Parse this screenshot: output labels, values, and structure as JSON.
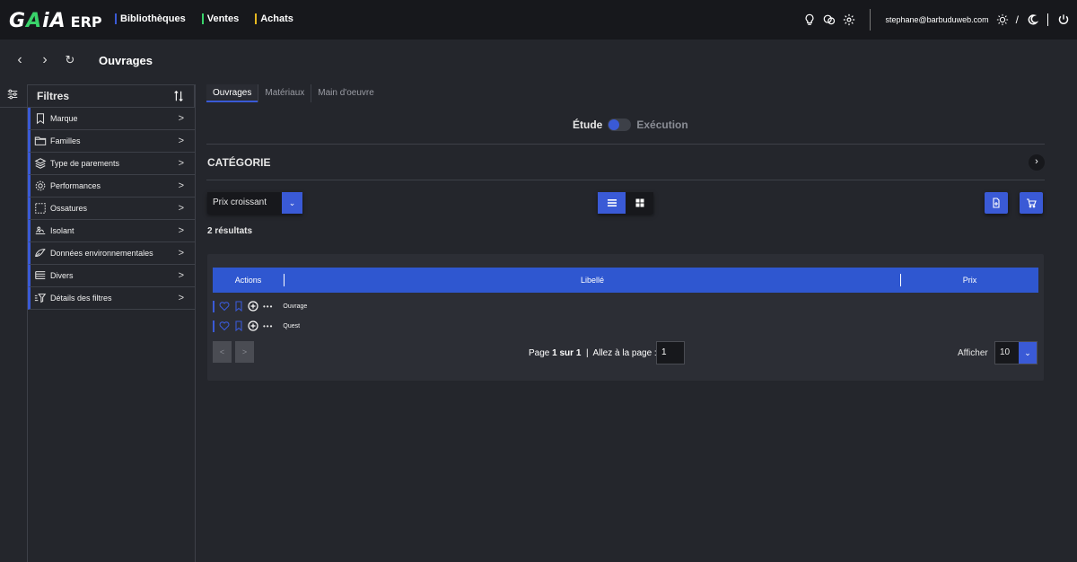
{
  "app": {
    "logo_text": "GAiA",
    "logo_suffix": "ERP"
  },
  "topnav": [
    {
      "label": "Bibliothèques",
      "color": "#3a5ad6"
    },
    {
      "label": "Ventes",
      "color": "#39d36a"
    },
    {
      "label": "Achats",
      "color": "#e6b820"
    }
  ],
  "topright": {
    "icons": [
      "lightbulb-icon",
      "chat-icon",
      "gear-icon"
    ],
    "email": "stephane@barbuduweb.com",
    "theme_separator": "/",
    "theme_icons": [
      "sun-icon",
      "moon-icon"
    ],
    "power_icon": "power-icon"
  },
  "subheader": {
    "back": "‹",
    "forward": "›",
    "refresh": "↻",
    "title": "Ouvrages"
  },
  "filters": {
    "title": "Filtres",
    "items": [
      {
        "label": "Marque",
        "icon": "bookmark-icon"
      },
      {
        "label": "Familles",
        "icon": "folder-icon"
      },
      {
        "label": "Type de parements",
        "icon": "layers-icon"
      },
      {
        "label": "Performances",
        "icon": "cog-icon"
      },
      {
        "label": "Ossatures",
        "icon": "frame-icon"
      },
      {
        "label": "Isolant",
        "icon": "insulation-icon"
      },
      {
        "label": "Données environnementales",
        "icon": "leaf-icon"
      },
      {
        "label": "Divers",
        "icon": "list-icon"
      },
      {
        "label": "Détails des filtres",
        "icon": "filter-details-icon"
      }
    ]
  },
  "main": {
    "tabs": [
      {
        "label": "Ouvrages",
        "active": true
      },
      {
        "label": "Matériaux",
        "active": false
      },
      {
        "label": "Main d'oeuvre",
        "active": false
      }
    ],
    "toggle": {
      "left": "Étude",
      "right": "Exécution"
    },
    "category": "CATÉGORIE",
    "sort": {
      "value": "Prix croissant"
    },
    "results": "2 résultats",
    "table": {
      "headers": [
        "Actions",
        "Libellé",
        "Prix"
      ],
      "rows": [
        {
          "label": "Ouvrage"
        },
        {
          "label": "Quest"
        }
      ],
      "ellipsis": "•••"
    },
    "pagination": {
      "prev": "<",
      "next": ">",
      "page_prefix": "Page ",
      "page_current": "1 sur 1",
      "goto_label": "  |  Allez à la page :",
      "goto_value": "1",
      "show_label": "Afficher",
      "per_page": "10"
    }
  },
  "colors": {
    "accent": "#3a5ad6",
    "background": "#24262c",
    "topbar": "#17181c"
  }
}
